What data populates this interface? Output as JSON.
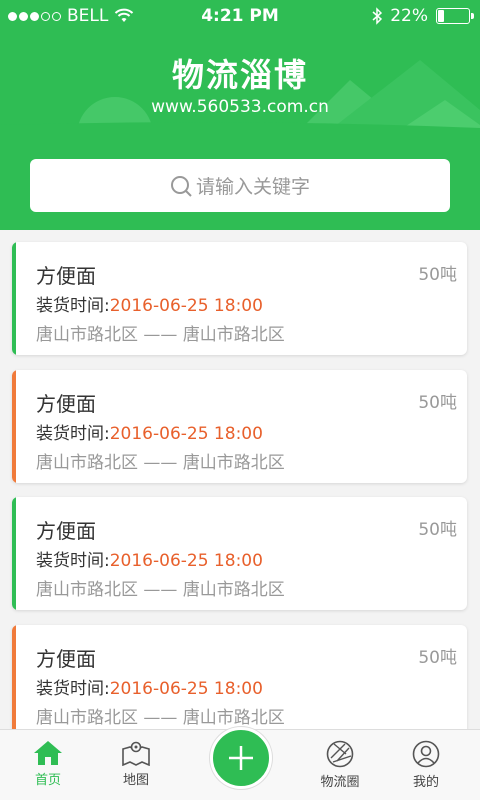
{
  "status": {
    "carrier": "BELL",
    "time": "4:21 PM",
    "battery_text": "22%",
    "battery_level": 0.22
  },
  "header": {
    "title": "物流淄博",
    "url": "www.560533.com.cn"
  },
  "search": {
    "placeholder": "请输入关键字"
  },
  "cards": [
    {
      "name": "方便面",
      "weight": "50吨",
      "time_label": "装货时间:",
      "time_value": "2016-06-25  18:00",
      "from": "唐山市路北区",
      "sep": "——",
      "to": "唐山市路北区",
      "accent": "#2fbd54"
    },
    {
      "name": "方便面",
      "weight": "50吨",
      "time_label": "装货时间:",
      "time_value": "2016-06-25  18:00",
      "from": "唐山市路北区",
      "sep": "——",
      "to": "唐山市路北区",
      "accent": "#f07a3a"
    },
    {
      "name": "方便面",
      "weight": "50吨",
      "time_label": "装货时间:",
      "time_value": "2016-06-25  18:00",
      "from": "唐山市路北区",
      "sep": "——",
      "to": "唐山市路北区",
      "accent": "#2fbd54"
    },
    {
      "name": "方便面",
      "weight": "50吨",
      "time_label": "装货时间:",
      "time_value": "2016-06-25  18:00",
      "from": "唐山市路北区",
      "sep": "——",
      "to": "唐山市路北区",
      "accent": "#f07a3a"
    }
  ],
  "tabs": [
    {
      "label": "首页",
      "icon": "home-icon",
      "active": true
    },
    {
      "label": "地图",
      "icon": "map-icon",
      "active": false
    },
    {
      "label": "",
      "icon": "plus-icon",
      "active": false
    },
    {
      "label": "物流圈",
      "icon": "aperture-icon",
      "active": false
    },
    {
      "label": "我的",
      "icon": "user-icon",
      "active": false
    }
  ],
  "colors": {
    "brand": "#2fbd54",
    "time_value": "#e8602c"
  }
}
